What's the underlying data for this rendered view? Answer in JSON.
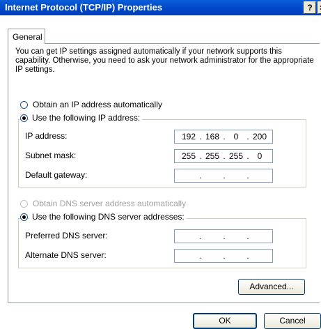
{
  "window": {
    "title": "Internet Protocol (TCP/IP) Properties",
    "help_label": "?",
    "close_label": "×"
  },
  "tabs": [
    {
      "label": "General"
    }
  ],
  "intro": "You can get IP settings assigned automatically if your network supports this capability. Otherwise, you need to ask your network administrator for the appropriate IP settings.",
  "ip_options": {
    "auto_label": "Obtain an IP address automatically",
    "manual_label": "Use the following IP address:",
    "selected": "manual"
  },
  "ip_fields": {
    "ip_label": "IP address:",
    "ip_value": [
      "192",
      "168",
      "0",
      "200"
    ],
    "subnet_label": "Subnet mask:",
    "subnet_value": [
      "255",
      "255",
      "255",
      "0"
    ],
    "gateway_label": "Default gateway:",
    "gateway_value": [
      "",
      "",
      "",
      ""
    ],
    "dot": "."
  },
  "dns_options": {
    "auto_label": "Obtain DNS server address automatically",
    "manual_label": "Use the following DNS server addresses:",
    "selected": "manual"
  },
  "dns_fields": {
    "preferred_label": "Preferred DNS server:",
    "preferred_value": [
      "",
      "",
      "",
      ""
    ],
    "alternate_label": "Alternate DNS server:",
    "alternate_value": [
      "",
      "",
      "",
      ""
    ]
  },
  "buttons": {
    "advanced": "Advanced...",
    "ok": "OK",
    "cancel": "Cancel"
  }
}
